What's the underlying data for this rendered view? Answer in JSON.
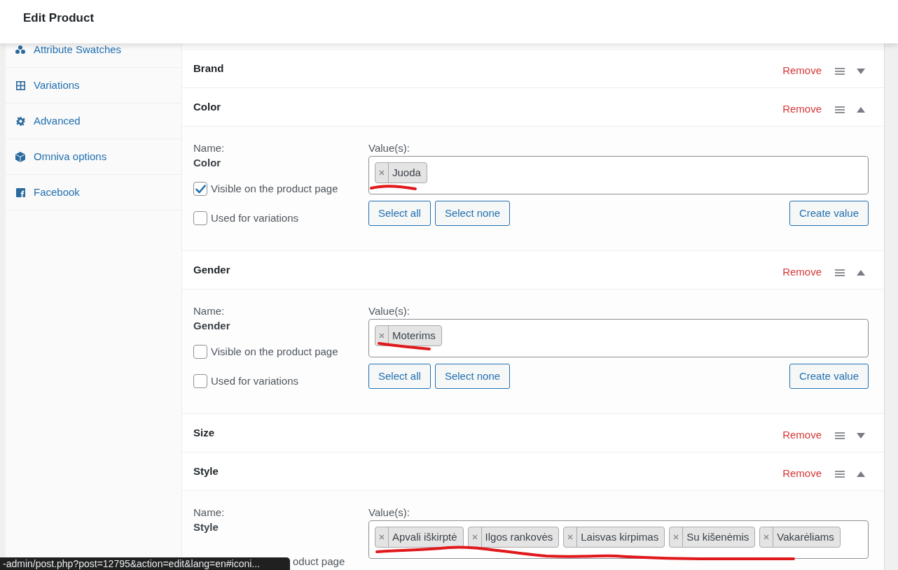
{
  "header": {
    "title": "Edit Product"
  },
  "sidebar": {
    "items": [
      {
        "label": "Attribute Swatches",
        "kind": "dots",
        "selected": false
      },
      {
        "label": "Variations",
        "kind": "grid",
        "selected": false
      },
      {
        "label": "Advanced",
        "kind": "gear",
        "selected": false
      },
      {
        "label": "Omniva options",
        "kind": "cube",
        "selected": false
      },
      {
        "label": "Facebook",
        "kind": "facebook",
        "selected": false
      }
    ]
  },
  "attributes": [
    {
      "name": "Brand",
      "expanded": false,
      "remove": "Remove"
    },
    {
      "name": "Color",
      "expanded": true,
      "remove": "Remove",
      "name_label": "Name:",
      "name_value": "Color",
      "visible": {
        "label": "Visible on the product page",
        "checked": true
      },
      "used_for_variations": {
        "label": "Used for variations",
        "checked": false
      },
      "values_label": "Value(s):",
      "values": [
        "Juoda"
      ],
      "select_all": "Select all",
      "select_none": "Select none",
      "create_value": "Create value"
    },
    {
      "name": "Gender",
      "expanded": true,
      "remove": "Remove",
      "name_label": "Name:",
      "name_value": "Gender",
      "visible": {
        "label": "Visible on the product page",
        "checked": false
      },
      "used_for_variations": {
        "label": "Used for variations",
        "checked": false
      },
      "values_label": "Value(s):",
      "values": [
        "Moterims"
      ],
      "select_all": "Select all",
      "select_none": "Select none",
      "create_value": "Create value"
    },
    {
      "name": "Size",
      "expanded": false,
      "remove": "Remove"
    },
    {
      "name": "Style",
      "expanded": true,
      "remove": "Remove",
      "name_label": "Name:",
      "name_value": "Style",
      "visible": {
        "label": "oduct page"
      },
      "values_label": "Value(s):",
      "values": [
        "Apvali iškirptė",
        "Ilgos rankovės",
        "Laisvas kirpimas",
        "Su kišenėmis",
        "Vakarėliams"
      ]
    }
  ],
  "status_bar": {
    "url": "-admin/post.php?post=12795&action=edit&lang=en#iconi..."
  }
}
